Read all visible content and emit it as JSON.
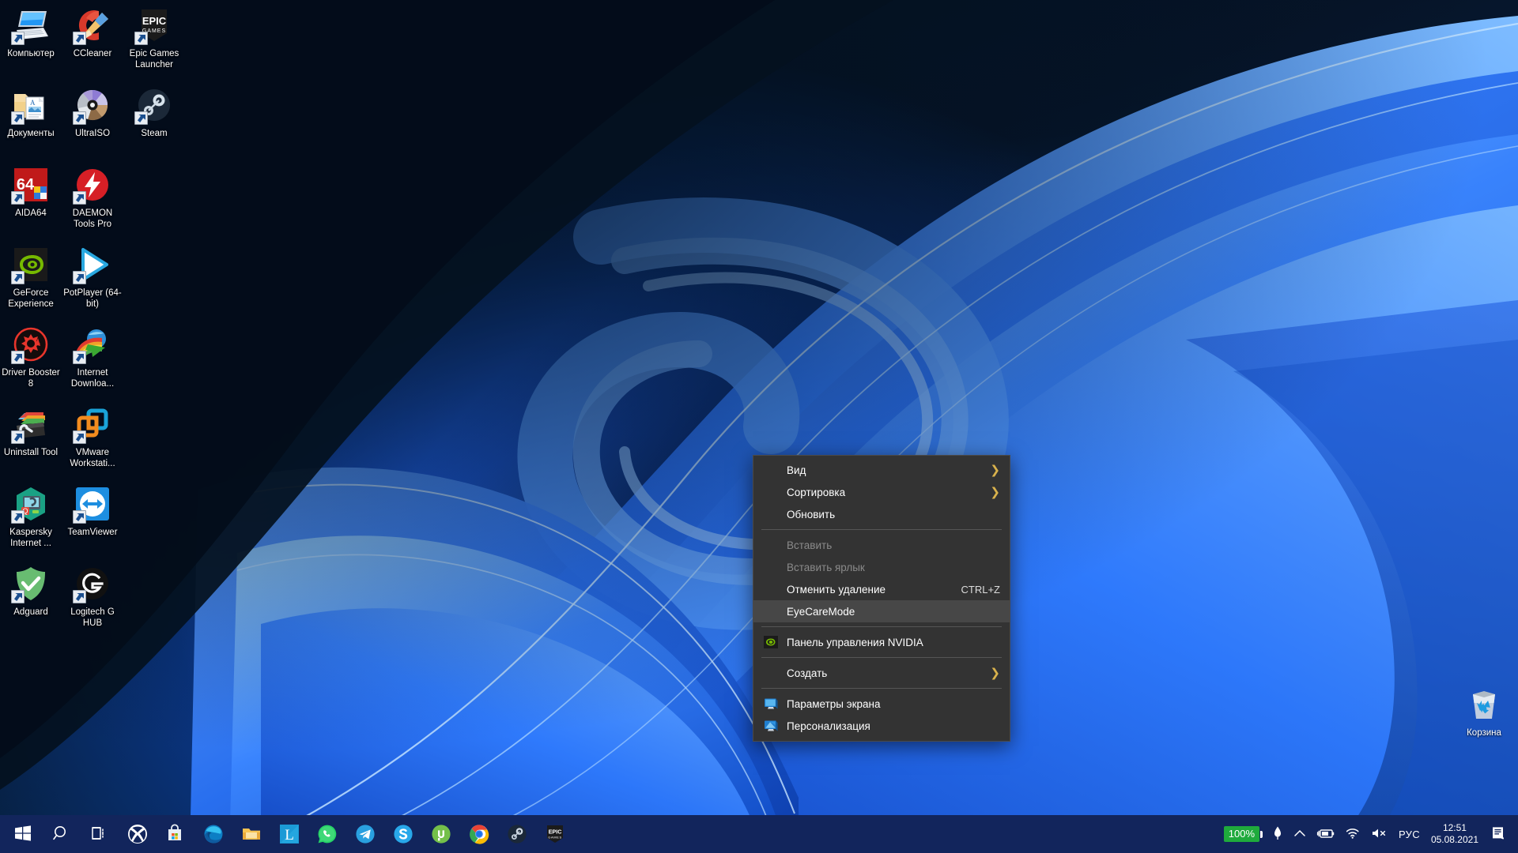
{
  "desktop": {
    "wallpaper_name": "windows-11-bloom-blue",
    "colors": {
      "wallpaper_dark": "#071226",
      "wallpaper_blue": "#1f63f0",
      "wallpaper_light_blue": "#3b86ff",
      "taskbar": "#12255c",
      "menu_bg": "#333333",
      "menu_selected": "#474747",
      "menu_disabled_text": "#8a8a8a",
      "submenu_arrow": "#d9b24c",
      "battery_green": "#1faa3c"
    },
    "icons": [
      {
        "label": "Компьютер",
        "icon": "computer-icon",
        "shortcut": true
      },
      {
        "label": "CCleaner",
        "icon": "ccleaner-icon",
        "shortcut": true
      },
      {
        "label": "Epic Games Launcher",
        "icon": "epic-games-launcher-icon",
        "shortcut": true
      },
      {
        "label": "Документы",
        "icon": "documents-folder-icon",
        "shortcut": true
      },
      {
        "label": "UltraISO",
        "icon": "ultraiso-icon",
        "shortcut": true
      },
      {
        "label": "Steam",
        "icon": "steam-icon",
        "shortcut": true
      },
      {
        "label": "AIDA64",
        "icon": "aida64-icon",
        "shortcut": true
      },
      {
        "label": "DAEMON Tools Pro",
        "icon": "daemon-tools-pro-icon",
        "shortcut": true
      },
      {
        "label": "",
        "icon": "empty-cell",
        "shortcut": false
      },
      {
        "label": "GeForce Experience",
        "icon": "geforce-experience-icon",
        "shortcut": true
      },
      {
        "label": "PotPlayer (64-bit)",
        "icon": "potplayer-icon",
        "shortcut": true
      },
      {
        "label": "",
        "icon": "empty-cell",
        "shortcut": false
      },
      {
        "label": "Driver Booster 8",
        "icon": "driver-booster-icon",
        "shortcut": true
      },
      {
        "label": "Internet Downloa...",
        "icon": "internet-download-manager-icon",
        "shortcut": true
      },
      {
        "label": "",
        "icon": "empty-cell",
        "shortcut": false
      },
      {
        "label": "Uninstall Tool",
        "icon": "uninstall-tool-icon",
        "shortcut": true
      },
      {
        "label": "VMware Workstati...",
        "icon": "vmware-workstation-icon",
        "shortcut": true
      },
      {
        "label": "",
        "icon": "empty-cell",
        "shortcut": false
      },
      {
        "label": "Kaspersky Internet ...",
        "icon": "kaspersky-internet-security-icon",
        "shortcut": true
      },
      {
        "label": "TeamViewer",
        "icon": "teamviewer-icon",
        "shortcut": true
      },
      {
        "label": "",
        "icon": "empty-cell",
        "shortcut": false
      },
      {
        "label": "Adguard",
        "icon": "adguard-icon",
        "shortcut": true
      },
      {
        "label": "Logitech G HUB",
        "icon": "logitech-g-hub-icon",
        "shortcut": true
      },
      {
        "label": "",
        "icon": "empty-cell",
        "shortcut": false
      }
    ],
    "recycle_bin": {
      "label": "Корзина",
      "icon": "recycle-bin-icon"
    }
  },
  "context_menu": {
    "name": "desktop-context-menu",
    "selected_item": "EyeCareMode",
    "items": [
      {
        "label": "Вид",
        "icon": null,
        "accel": "",
        "submenu": true,
        "disabled": false,
        "separator_after": false
      },
      {
        "label": "Сортировка",
        "icon": null,
        "accel": "",
        "submenu": true,
        "disabled": false,
        "separator_after": false
      },
      {
        "label": "Обновить",
        "icon": null,
        "accel": "",
        "submenu": false,
        "disabled": false,
        "separator_after": true
      },
      {
        "label": "Вставить",
        "icon": null,
        "accel": "",
        "submenu": false,
        "disabled": true,
        "separator_after": false
      },
      {
        "label": "Вставить ярлык",
        "icon": null,
        "accel": "",
        "submenu": false,
        "disabled": true,
        "separator_after": false
      },
      {
        "label": "Отменить удаление",
        "icon": null,
        "accel": "CTRL+Z",
        "submenu": false,
        "disabled": false,
        "separator_after": false
      },
      {
        "label": "EyeCareMode",
        "icon": null,
        "accel": "",
        "submenu": false,
        "disabled": false,
        "separator_after": true
      },
      {
        "label": "Панель управления NVIDIA",
        "icon": "nvidia-icon",
        "accel": "",
        "submenu": false,
        "disabled": false,
        "separator_after": true
      },
      {
        "label": "Создать",
        "icon": null,
        "accel": "",
        "submenu": true,
        "disabled": false,
        "separator_after": true
      },
      {
        "label": "Параметры экрана",
        "icon": "display-settings-icon",
        "accel": "",
        "submenu": false,
        "disabled": false,
        "separator_after": false
      },
      {
        "label": "Персонализация",
        "icon": "personalization-icon",
        "accel": "",
        "submenu": false,
        "disabled": false,
        "separator_after": false
      }
    ]
  },
  "taskbar": {
    "buttons": [
      {
        "name": "start-button",
        "icon": "windows-logo-icon",
        "tooltip": "Пуск"
      },
      {
        "name": "search-button",
        "icon": "search-icon",
        "tooltip": "Поиск"
      },
      {
        "name": "task-view-button",
        "icon": "task-view-icon",
        "tooltip": "Представление задач"
      },
      {
        "name": "xbox-button",
        "icon": "xbox-icon",
        "tooltip": "Xbox"
      },
      {
        "name": "store-button",
        "icon": "microsoft-store-icon",
        "tooltip": "Microsoft Store"
      },
      {
        "name": "edge-button",
        "icon": "microsoft-edge-icon",
        "tooltip": "Microsoft Edge"
      },
      {
        "name": "file-explorer-button",
        "icon": "file-explorer-icon",
        "tooltip": "Проводник"
      },
      {
        "name": "lightshot-button",
        "icon": "lightshot-icon",
        "tooltip": "Lightshot"
      },
      {
        "name": "whatsapp-button",
        "icon": "whatsapp-icon",
        "tooltip": "WhatsApp"
      },
      {
        "name": "telegram-button",
        "icon": "telegram-icon",
        "tooltip": "Telegram"
      },
      {
        "name": "skype-button",
        "icon": "skype-icon",
        "tooltip": "Skype"
      },
      {
        "name": "utorrent-button",
        "icon": "utorrent-icon",
        "tooltip": "uTorrent"
      },
      {
        "name": "chrome-button",
        "icon": "google-chrome-icon",
        "tooltip": "Google Chrome"
      },
      {
        "name": "steam-button",
        "icon": "steam-icon",
        "tooltip": "Steam"
      },
      {
        "name": "epic-games-button",
        "icon": "epic-games-icon",
        "tooltip": "Epic Games"
      }
    ],
    "tray": {
      "battery_percent": "100%",
      "items": [
        {
          "name": "battery-percent-badge",
          "icon": "battery-percent-icon"
        },
        {
          "name": "tray-pen-icon",
          "icon": "pen-icon"
        },
        {
          "name": "show-hidden-icons",
          "icon": "chevron-up-icon"
        },
        {
          "name": "battery-status-icon",
          "icon": "battery-charging-icon"
        },
        {
          "name": "network-icon",
          "icon": "wifi-icon"
        },
        {
          "name": "volume-icon",
          "icon": "speaker-muted-icon"
        },
        {
          "name": "language-indicator",
          "icon": "language-icon"
        }
      ],
      "language": "РУС",
      "clock": {
        "time": "12:51",
        "date": "05.08.2021"
      },
      "notification_center": {
        "name": "notification-center-button",
        "icon": "notification-icon"
      }
    }
  }
}
